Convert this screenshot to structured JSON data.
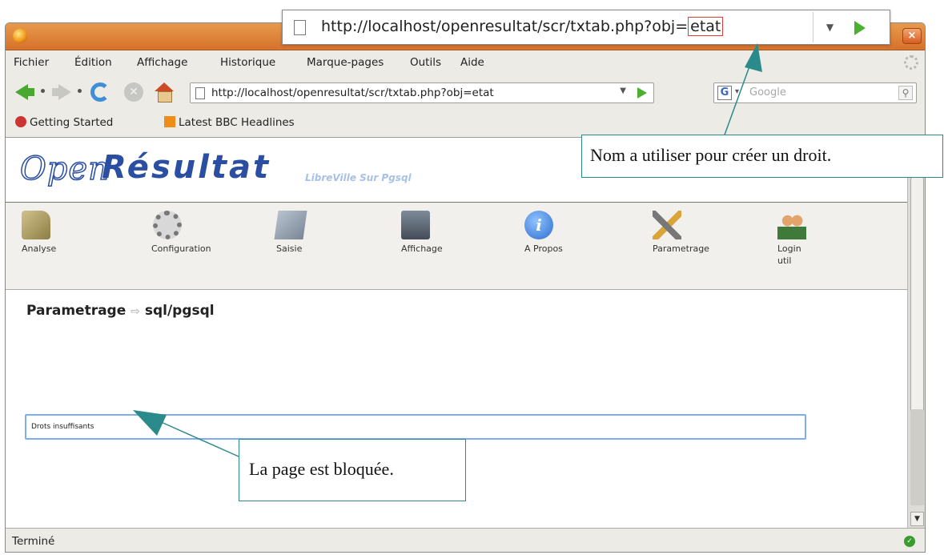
{
  "callout_url": {
    "prefix": "http://localhost/openresultat/scr/txtab.php?obj=",
    "highlight": "etat",
    "drop_symbol": "▼"
  },
  "menu": {
    "fichier": "Fichier",
    "edition": "Édition",
    "affichage": "Affichage",
    "historique": "Historique",
    "marque_pages": "Marque-pages",
    "outils": "Outils",
    "aide": "Aide"
  },
  "navbar": {
    "url": "http://localhost/openresultat/scr/txtab.php?obj=etat",
    "url_drop_symbol": "▼",
    "search_placeholder": "Google",
    "search_engine_letter": "G",
    "search_engine_drop_symbol": "▾",
    "search_symbol": "⚲",
    "stop_symbol": "✕"
  },
  "bookmarks": {
    "getting_started": "Getting Started",
    "latest_bbc": "Latest BBC Headlines"
  },
  "logo": {
    "open": "Open",
    "resultat": "Résultat",
    "subtitle": "LibreVille Sur Pgsql"
  },
  "tabs": {
    "analyse": "Analyse",
    "configuration": "Configuration",
    "saisie": "Saisie",
    "affichage": "Affichage",
    "apropos": "A Propos",
    "apropos_symbol": "i",
    "parametrage": "Parametrage",
    "login_line1": "Login",
    "login_line2": "util"
  },
  "breadcrumb": {
    "section": "Parametrage",
    "arrow": "⇨",
    "page": "sql/pgsql"
  },
  "message": "Drots insuffisants",
  "status": {
    "text": "Terminé",
    "ok_symbol": "✓",
    "scroll_down_symbol": "▼"
  },
  "annotations": {
    "droit": "Nom a utiliser pour créer un droit.",
    "bloquee": "La page est bloquée."
  },
  "colors": {
    "titlebar": "#e0843a",
    "highlight_border": "#e23b3b",
    "annotation_line": "#2b8a8a",
    "logo_blue": "#2a4fa2",
    "message_border": "#7eaef0"
  }
}
